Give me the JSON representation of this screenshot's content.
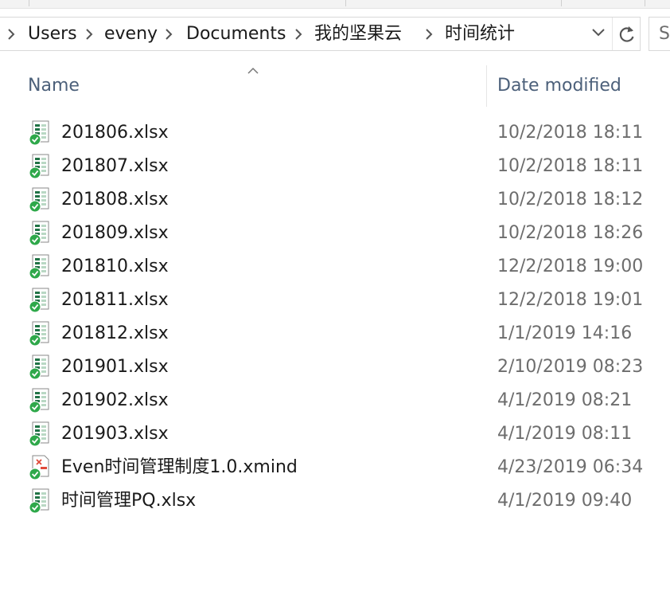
{
  "breadcrumb": {
    "items": [
      "Users",
      "eveny",
      "Documents",
      "我的坚果云",
      "时间统计"
    ]
  },
  "search": {
    "placeholder_visible": "S"
  },
  "columns": {
    "name": "Name",
    "date_modified": "Date modified"
  },
  "files": [
    {
      "name": "201806.xlsx",
      "date": "10/2/2018 18:11",
      "type": "excel"
    },
    {
      "name": "201807.xlsx",
      "date": "10/2/2018 18:11",
      "type": "excel"
    },
    {
      "name": "201808.xlsx",
      "date": "10/2/2018 18:12",
      "type": "excel"
    },
    {
      "name": "201809.xlsx",
      "date": "10/2/2018 18:26",
      "type": "excel"
    },
    {
      "name": "201810.xlsx",
      "date": "12/2/2018 19:00",
      "type": "excel"
    },
    {
      "name": "201811.xlsx",
      "date": "12/2/2018 19:01",
      "type": "excel"
    },
    {
      "name": "201812.xlsx",
      "date": "1/1/2019 14:16",
      "type": "excel"
    },
    {
      "name": "201901.xlsx",
      "date": "2/10/2019 08:23",
      "type": "excel"
    },
    {
      "name": "201902.xlsx",
      "date": "4/1/2019 08:21",
      "type": "excel"
    },
    {
      "name": "201903.xlsx",
      "date": "4/1/2019 08:11",
      "type": "excel"
    },
    {
      "name": "Even时间管理制度1.0.xmind",
      "date": "4/23/2019 06:34",
      "type": "xmind"
    },
    {
      "name": "时间管理PQ.xlsx",
      "date": "4/1/2019 09:40",
      "type": "excel"
    }
  ],
  "icons": {
    "breadcrumb_separator": "chevron-right-icon",
    "dropdown": "chevron-down-icon",
    "refresh": "refresh-icon",
    "sort": "sort-ascending-icon",
    "excel_file": "excel-file-icon",
    "xmind_file": "xmind-file-icon",
    "sync_status": "sync-ok-icon"
  },
  "colors": {
    "header_text": "#4c607a",
    "date_text": "#6d6d6d",
    "sync_green": "#2ea84a",
    "excel_green": "#217346"
  }
}
